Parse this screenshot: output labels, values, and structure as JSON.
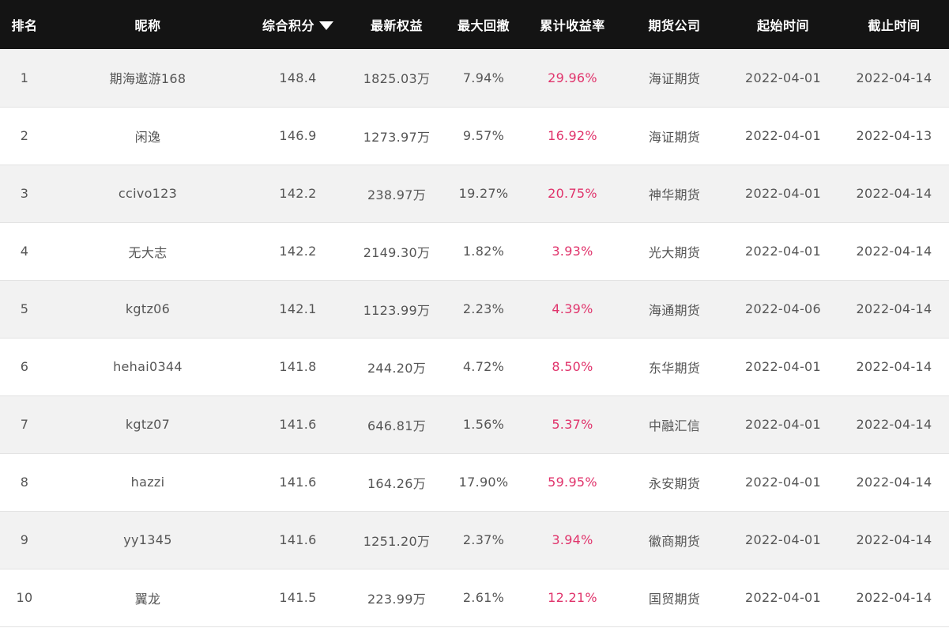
{
  "table": {
    "headers": {
      "rank": "排名",
      "nickname": "昵称",
      "score": "综合积分",
      "equity": "最新权益",
      "drawdown": "最大回撤",
      "return": "累计收益率",
      "company": "期货公司",
      "start": "起始时间",
      "end": "截止时间"
    },
    "sort_icon": "triangle-down-icon",
    "rows": [
      {
        "rank": "1",
        "nickname": "期海遨游168",
        "score": "148.4",
        "equity": "1825.03万",
        "drawdown": "7.94%",
        "return": "29.96%",
        "company": "海证期货",
        "start": "2022-04-01",
        "end": "2022-04-14"
      },
      {
        "rank": "2",
        "nickname": "闲逸",
        "score": "146.9",
        "equity": "1273.97万",
        "drawdown": "9.57%",
        "return": "16.92%",
        "company": "海证期货",
        "start": "2022-04-01",
        "end": "2022-04-13"
      },
      {
        "rank": "3",
        "nickname": "ccivo123",
        "score": "142.2",
        "equity": "238.97万",
        "drawdown": "19.27%",
        "return": "20.75%",
        "company": "神华期货",
        "start": "2022-04-01",
        "end": "2022-04-14"
      },
      {
        "rank": "4",
        "nickname": "无大志",
        "score": "142.2",
        "equity": "2149.30万",
        "drawdown": "1.82%",
        "return": "3.93%",
        "company": "光大期货",
        "start": "2022-04-01",
        "end": "2022-04-14"
      },
      {
        "rank": "5",
        "nickname": "kgtz06",
        "score": "142.1",
        "equity": "1123.99万",
        "drawdown": "2.23%",
        "return": "4.39%",
        "company": "海通期货",
        "start": "2022-04-06",
        "end": "2022-04-14"
      },
      {
        "rank": "6",
        "nickname": "hehai0344",
        "score": "141.8",
        "equity": "244.20万",
        "drawdown": "4.72%",
        "return": "8.50%",
        "company": "东华期货",
        "start": "2022-04-01",
        "end": "2022-04-14"
      },
      {
        "rank": "7",
        "nickname": "kgtz07",
        "score": "141.6",
        "equity": "646.81万",
        "drawdown": "1.56%",
        "return": "5.37%",
        "company": "中融汇信",
        "start": "2022-04-01",
        "end": "2022-04-14"
      },
      {
        "rank": "8",
        "nickname": "hazzi",
        "score": "141.6",
        "equity": "164.26万",
        "drawdown": "17.90%",
        "return": "59.95%",
        "company": "永安期货",
        "start": "2022-04-01",
        "end": "2022-04-14"
      },
      {
        "rank": "9",
        "nickname": "yy1345",
        "score": "141.6",
        "equity": "1251.20万",
        "drawdown": "2.37%",
        "return": "3.94%",
        "company": "徽商期货",
        "start": "2022-04-01",
        "end": "2022-04-14"
      },
      {
        "rank": "10",
        "nickname": "翼龙",
        "score": "141.5",
        "equity": "223.99万",
        "drawdown": "2.61%",
        "return": "12.21%",
        "company": "国贸期货",
        "start": "2022-04-01",
        "end": "2022-04-14"
      }
    ]
  },
  "colors": {
    "header_bg": "#141414",
    "header_text": "#ffffff",
    "row_odd": "#f2f2f2",
    "row_even": "#ffffff",
    "text": "#555555",
    "return_accent": "#e0336b"
  }
}
